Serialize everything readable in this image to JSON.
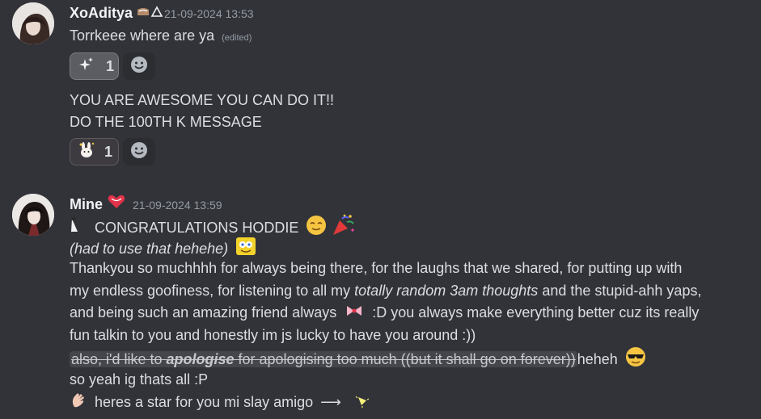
{
  "messages": [
    {
      "author": "XoAditya",
      "badge_icon": "badge-icons",
      "timestamp": "21-09-2024 13:53",
      "text": "Torrkeee where are ya",
      "edited": "(edited)",
      "reactions": [
        {
          "emoji": "sparkles-icon",
          "count": "1"
        }
      ]
    },
    {
      "lines": [
        "YOU ARE AWESOME YOU CAN DO IT!!",
        "DO THE 100TH K MESSAGE"
      ],
      "reactions": [
        {
          "emoji": "bunny-icon",
          "count": "1"
        }
      ]
    },
    {
      "author": "Mine",
      "author_icon": "heart-icon",
      "timestamp": "21-09-2024 13:59",
      "line1": "CONGRATULATIONS HODDIE",
      "line2": "(had to use that hehehe)",
      "para_a1": "Thankyou so muchhhh for always being there, for the laughs that we shared, for putting up with",
      "para_b1": "my endless goofiness, for listening to all my ",
      "para_b2": "totally random 3am thoughts",
      "para_b3": " and the stupid-ahh yaps,",
      "para_c1": "and being such an amazing friend always",
      "para_c2": ":D you always make everything better cuz its really",
      "para_d": "fun talkin to you and honestly im js lucky to have you around :))",
      "spoiler_a": "also, i'd like to ",
      "spoiler_b": "apologise",
      "spoiler_c": " for apologising too much ((but it shall go on forever))",
      "after_spoiler": "heheh",
      "line_so": "so yeah ig thats all :P",
      "line_star": "heres a star for you mi slay amigo",
      "arrow": "⟶"
    }
  ],
  "colors": {
    "background": "#323339",
    "text": "#dbdee1",
    "muted": "#949ba4"
  }
}
